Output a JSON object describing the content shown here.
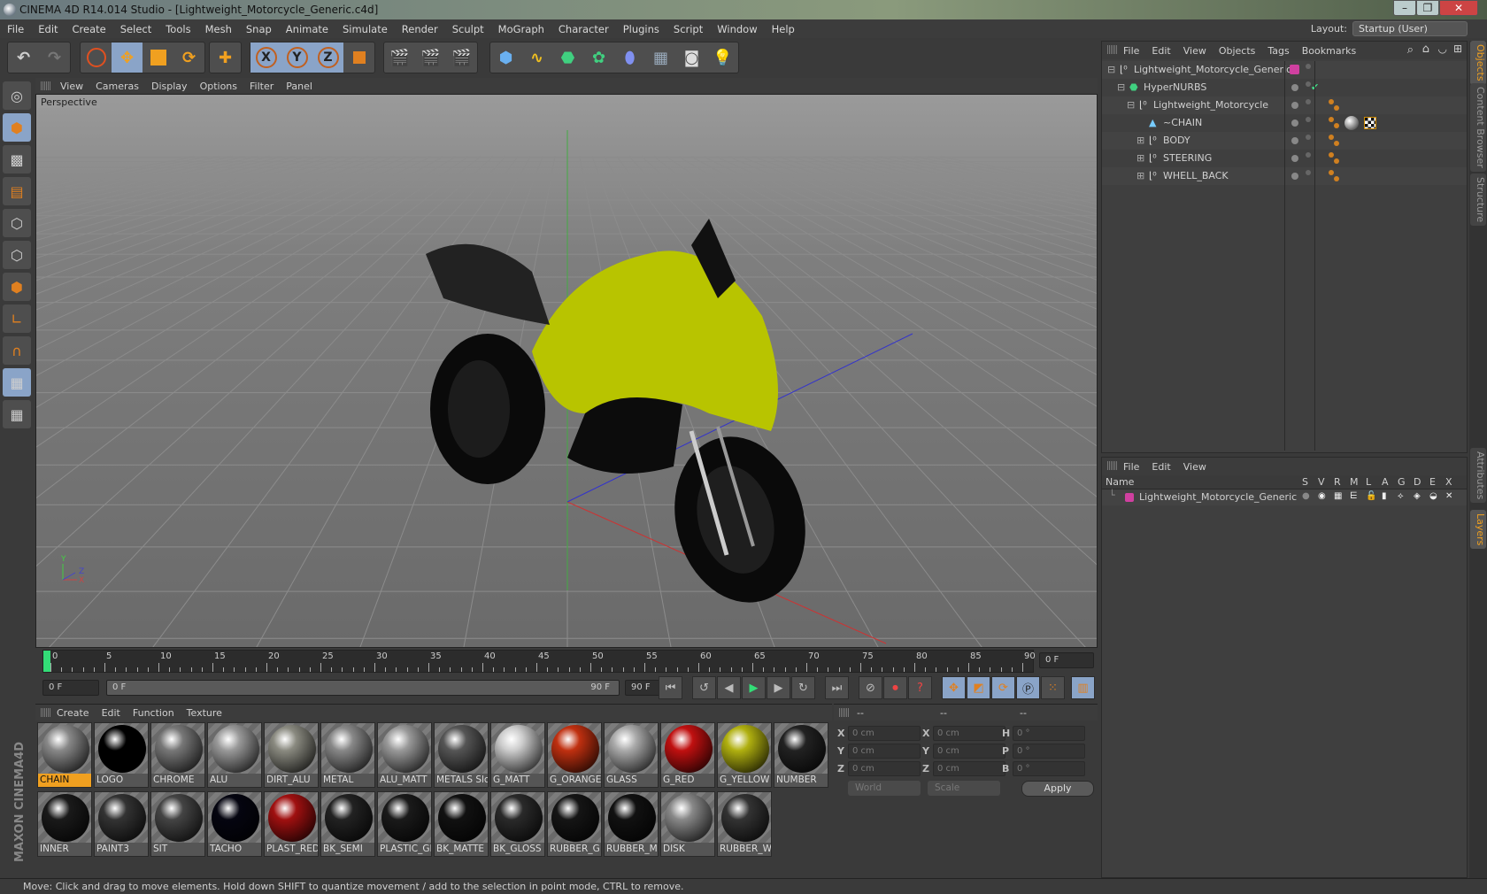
{
  "window": {
    "title": "CINEMA 4D R14.014 Studio - [Lightweight_Motorcycle_Generic.c4d]",
    "min": "–",
    "max": "❐",
    "close": "✕"
  },
  "menu": [
    "File",
    "Edit",
    "Create",
    "Select",
    "Tools",
    "Mesh",
    "Snap",
    "Animate",
    "Simulate",
    "Render",
    "Sculpt",
    "MoGraph",
    "Character",
    "Plugins",
    "Script",
    "Window",
    "Help"
  ],
  "layout": {
    "label": "Layout:",
    "value": "Startup (User)"
  },
  "toolbar": {
    "undo": "↶",
    "redo": "↷",
    "x": "X",
    "y": "Y",
    "z": "Z"
  },
  "viewport": {
    "menu": [
      "View",
      "Cameras",
      "Display",
      "Options",
      "Filter",
      "Panel"
    ],
    "label": "Perspective",
    "axis": {
      "x": "X",
      "y": "Y",
      "z": "Z"
    }
  },
  "timeline": {
    "ticks": [
      "0",
      "5",
      "10",
      "15",
      "20",
      "25",
      "30",
      "35",
      "40",
      "45",
      "50",
      "55",
      "60",
      "65",
      "70",
      "75",
      "80",
      "85",
      "90"
    ],
    "current": "0 F",
    "start": "0 F",
    "range_start": "0 F",
    "range_end": "90 F",
    "end": "90 F",
    "accent": "#33dd77"
  },
  "materials": {
    "menu": [
      "Create",
      "Edit",
      "Function",
      "Texture"
    ],
    "row1": [
      {
        "n": "CHAIN",
        "c": "#888",
        "sel": true
      },
      {
        "n": "LOGO",
        "c": "#000"
      },
      {
        "n": "CHROME",
        "c": "#777"
      },
      {
        "n": "ALU",
        "c": "#999"
      },
      {
        "n": "DIRT_ALU",
        "c": "#8a8a80"
      },
      {
        "n": "METAL",
        "c": "#888"
      },
      {
        "n": "ALU_MATT",
        "c": "#999"
      },
      {
        "n": "METALS Slc",
        "c": "#555"
      },
      {
        "n": "G_MATT",
        "c": "#ccc"
      },
      {
        "n": "G_ORANGE",
        "c": "#c03010"
      },
      {
        "n": "GLASS",
        "c": "#aaa"
      },
      {
        "n": "G_RED",
        "c": "#c01010"
      },
      {
        "n": "G_YELLOW",
        "c": "#b0b010"
      },
      {
        "n": "NUMBER",
        "c": "#222"
      }
    ],
    "row2": [
      {
        "n": "INNER",
        "c": "#1a1a1a"
      },
      {
        "n": "PAINT3",
        "c": "#333"
      },
      {
        "n": "SIT",
        "c": "#444"
      },
      {
        "n": "TACHO",
        "c": "#050510"
      },
      {
        "n": "PLAST_RED",
        "c": "#a01010"
      },
      {
        "n": "BK_SEMI",
        "c": "#222"
      },
      {
        "n": "PLASTIC_GL",
        "c": "#1a1a1a"
      },
      {
        "n": "BK_MATTE",
        "c": "#111"
      },
      {
        "n": "BK_GLOSS",
        "c": "#2a2a2a"
      },
      {
        "n": "RUBBER_G",
        "c": "#151515"
      },
      {
        "n": "RUBBER_M",
        "c": "#111"
      },
      {
        "n": "DISK",
        "c": "#888"
      },
      {
        "n": "RUBBER_W",
        "c": "#333"
      }
    ]
  },
  "coords": {
    "head": [
      "--",
      "--",
      "--"
    ],
    "pos": [
      {
        "l": "X",
        "v": "0 cm"
      },
      {
        "l": "Y",
        "v": "0 cm"
      },
      {
        "l": "Z",
        "v": "0 cm"
      }
    ],
    "size": [
      {
        "l": "X",
        "v": "0 cm"
      },
      {
        "l": "Y",
        "v": "0 cm"
      },
      {
        "l": "Z",
        "v": "0 cm"
      }
    ],
    "rot": [
      {
        "l": "H",
        "v": "0 °"
      },
      {
        "l": "P",
        "v": "0 °"
      },
      {
        "l": "B",
        "v": "0 °"
      }
    ],
    "mode1": "World",
    "mode2": "Scale",
    "apply": "Apply"
  },
  "objects": {
    "menu": [
      "File",
      "Edit",
      "View",
      "Objects",
      "Tags",
      "Bookmarks"
    ],
    "items": [
      {
        "name": "Lightweight_Motorcycle_Generic",
        "depth": 0,
        "exp": "⊟"
      },
      {
        "name": "HyperNURBS",
        "depth": 1,
        "exp": "⊟"
      },
      {
        "name": "Lightweight_Motorcycle",
        "depth": 2,
        "exp": "⊟"
      },
      {
        "name": "~CHAIN",
        "depth": 3,
        "exp": ""
      },
      {
        "name": "BODY",
        "depth": 3,
        "exp": "⊞"
      },
      {
        "name": "STEERING",
        "depth": 3,
        "exp": "⊞"
      },
      {
        "name": "WHELL_BACK",
        "depth": 3,
        "exp": "⊞"
      }
    ],
    "layer_color": "#d040a0",
    "check": "✔"
  },
  "layers": {
    "menu": [
      "File",
      "Edit",
      "View"
    ],
    "cols": [
      "S",
      "V",
      "R",
      "M",
      "L",
      "A",
      "G",
      "D",
      "E",
      "X"
    ],
    "name_col": "Name",
    "row": "Lightweight_Motorcycle_Generic"
  },
  "side_tabs": [
    "Objects",
    "Content Browser",
    "Structure",
    "Attributes",
    "Layers"
  ],
  "brand": "MAXON CINEMA4D",
  "status": "Move: Click and drag to move elements. Hold down SHIFT to quantize movement / add to the selection in point mode, CTRL to remove."
}
